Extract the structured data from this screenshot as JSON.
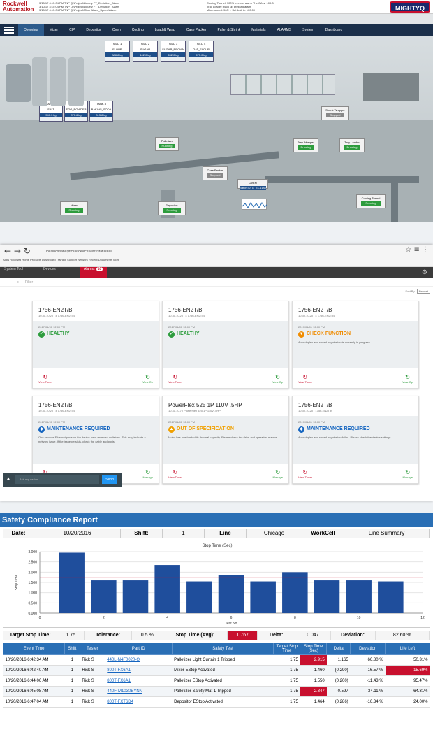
{
  "hmi": {
    "brand": {
      "line1": "Rockwell",
      "line2": "Automation"
    },
    "alarms": [
      "3/10/17 4:15:04 PM   TNP    Q:\\Project\\Liquefy FT_Deviation_Alarm",
      "3/10/17 4:15:04 PM   TNP    Q:\\Project\\Liquefy FT_Deviation_Alarm",
      "3/10/17 4:15:04 PM   TNP    Q:\\Project\\Mixer Alarm_Speed/Alarm"
    ],
    "alarms_right": [
      "Cooling Tunnel: 100% overrun alarm  The CA is: 100.3",
      "Tray Loader: back up pressed alarm",
      "Mixer speed: 960+ . Set limit is: 100.00"
    ],
    "logo_right": "MIGHTYQ",
    "tabs": [
      "Overview",
      "Mixer",
      "CIP",
      "Depositor",
      "Oven",
      "Cooling",
      "Load & Wrap",
      "Case Packer",
      "Pallet & Shrink",
      "Materials",
      "ALARMS",
      "System",
      "Dashboard"
    ],
    "silos": [
      {
        "name": "SILO 1",
        "material": "FLOUR",
        "value": "888.8 kg"
      },
      {
        "name": "SILO 2",
        "material": "SUGAR",
        "value": "102.0 kg"
      },
      {
        "name": "SILO 3",
        "material": "SUGAR_BROWN",
        "value": "282.0 kg"
      },
      {
        "name": "SILO 4",
        "material": "OAT_FLOUR",
        "value": "673.0 kg"
      }
    ],
    "tanks": [
      {
        "name": "TANK 1",
        "material": "SALT",
        "value": "540.3 kg"
      },
      {
        "name": "TANK 2",
        "material": "EGG_POWDER",
        "value": "870.6 kg"
      },
      {
        "name": "TANK 3",
        "material": "BAKING_SODA",
        "value": "313.8 kg"
      }
    ],
    "machines": [
      {
        "name": "Shrink Wrapper",
        "status": "Stopped"
      },
      {
        "name": "Palletizer",
        "status": "Running"
      },
      {
        "name": "Tray Wrapper",
        "status": "Running"
      },
      {
        "name": "Tray Loader",
        "status": "Running"
      },
      {
        "name": "Case Packer",
        "status": "Stopped"
      },
      {
        "name": "Cooling Tunnel",
        "status": "Running"
      },
      {
        "name": "Mixer",
        "status": "Running"
      },
      {
        "name": "Depositor",
        "status": "Running"
      },
      {
        "name": "OVEN",
        "status": "Batch ID: G_24-4184"
      }
    ]
  },
  "browser": {
    "address": "localhost/analytics/#/devices/list?status=all",
    "bookmarks": "Apps  Rockwell  Home  Products  Dashboard  Training  Support  Network  Recent  Documents  More",
    "tabs": {
      "t1": "System Tool",
      "t2": "Devices",
      "t3": "Alarms",
      "alarm_count": "10"
    },
    "filter_placeholder": "Filter",
    "sort_label": "Sort By",
    "sort_value": "Newest",
    "cards": [
      {
        "title": "1756-EN2T/B",
        "sub": "10.30.10.20 | 4   1756-EN2T/B",
        "date": "2017/01/01 12:00 PM",
        "status": "HEALTHY",
        "kind": "ok",
        "desc": "",
        "left": "View Tuner",
        "right": "View Op"
      },
      {
        "title": "1756-EN2T/B",
        "sub": "10.30.10.20 | 4   1756-EN2T/B",
        "date": "2017/01/01 12:00 PM",
        "status": "HEALTHY",
        "kind": "ok",
        "desc": "",
        "left": "View Tuner",
        "right": "View Op"
      },
      {
        "title": "1756-EN2T/B",
        "sub": "10.30.10.20 | 4   1756-EN2T/B",
        "date": "2017/01/01 12:00 PM",
        "status": "CHECK FUNCTION",
        "kind": "check",
        "desc": "Auto duplex and speed negotiation is currently in progress.",
        "left": "View Tuner",
        "right": "View Op"
      },
      {
        "title": "1756-EN2T/B",
        "sub": "10.30.10.20 | 4   1756-EN2T/B",
        "date": "2017/01/01 12:00 PM",
        "status": "MAINTENANCE REQUIRED",
        "kind": "maint",
        "desc": "One or more Ethernet ports on the device have received collisions. This may indicate a network issue. If the issue persists, check the cable and ports.",
        "left": "View Tuner",
        "right": "Manage"
      },
      {
        "title": "PowerFlex 525 1P 110V .5HP",
        "sub": "10.31.10.7 | PowerFlex 525 1P 110V .5HP",
        "date": "2017/01/01 12:00 PM",
        "status": "OUT OF SPECIFICATION",
        "kind": "spec",
        "desc": "Motor has overloaded its thermal capacity. Please check the drive and operation manual.",
        "left": "View Tuner",
        "right": "Manage"
      },
      {
        "title": "1756-EN2T/B",
        "sub": "10.30.10.20 | 1756-EN2T/B",
        "date": "2017/01/01 12:00 PM",
        "status": "MAINTENANCE REQUIRED",
        "kind": "maint",
        "desc": "Auto duplex and speed negotiation failed. Please check the device settings.",
        "left": "View Tuner",
        "right": "Manage"
      }
    ],
    "chat": {
      "placeholder": "Ask a question",
      "button": "Send"
    }
  },
  "report": {
    "title": "Safety Compliance Report",
    "date_label": "Date:",
    "date": "10/20/2016",
    "shift_label": "Shift:",
    "shift": "1",
    "line_label": "Line",
    "line": "Chicago",
    "workcell_label": "WorkCell",
    "workcell": "Line Summary",
    "target_stop_label": "Target Stop Time:",
    "target_stop": "1.75",
    "tolerance_label": "Tolerance:",
    "tolerance": "0.5 %",
    "avg_label": "Stop Time (Avg):",
    "avg": "1.767",
    "delta_label": "Delta:",
    "delta": "0.047",
    "deviation_label": "Deviation:",
    "deviation": "82.60 %",
    "columns": [
      "Event Time",
      "Shift",
      "Tester",
      "Part ID",
      "Safety Test",
      "Target Stop Time",
      "Stop Time (Sec)",
      "Delta",
      "Deviation",
      "Life Left"
    ],
    "rows": [
      {
        "time": "10/20/2016 6:42:34 AM",
        "shift": "1",
        "tester": "Rick S",
        "part": "440L-N4F0020-Q",
        "test": "Palletizer Light Curtain 1 Tripped",
        "target": "1.75",
        "stop": "2.915",
        "delta": "1.165",
        "dev": "66.80 %",
        "life": "50.31%",
        "stop_red": true,
        "life_red": false
      },
      {
        "time": "10/20/2016 6:42:40 AM",
        "shift": "1",
        "tester": "Rick S",
        "part": "800T-FX6A1",
        "test": "Mixer EStop Activated",
        "target": "1.75",
        "stop": "1.460",
        "delta": "(0.290)",
        "dev": "-16.57 %",
        "life": "15.69%",
        "stop_red": false,
        "life_red": true
      },
      {
        "time": "10/20/2016 6:44:06 AM",
        "shift": "1",
        "tester": "Rick S",
        "part": "800T-FX6A1",
        "test": "Palletizer EStop Activated",
        "target": "1.75",
        "stop": "1.550",
        "delta": "(0.200)",
        "dev": "-11.43 %",
        "life": "95.47%",
        "stop_red": false,
        "life_red": false
      },
      {
        "time": "10/20/2016 6:45:08 AM",
        "shift": "1",
        "tester": "Rick S",
        "part": "440F-M1030BYNN",
        "test": "Palletizer Safety Mat 1 Tripped",
        "target": "1.75",
        "stop": "2.347",
        "delta": "0.597",
        "dev": "34.11 %",
        "life": "64.31%",
        "stop_red": true,
        "life_red": false
      },
      {
        "time": "10/20/2016 6:47:04 AM",
        "shift": "1",
        "tester": "Rick S",
        "part": "800T-FXT6D4",
        "test": "Depositor EStop Activated",
        "target": "1.75",
        "stop": "1.464",
        "delta": "(0.286)",
        "dev": "-16.34 %",
        "life": "24.00%",
        "stop_red": false,
        "life_red": false
      }
    ]
  },
  "chart_data": {
    "type": "bar",
    "title": "Stop Time (Sec)",
    "xlabel": "Test No",
    "ylabel": "Stop Time",
    "x": [
      1,
      2,
      3,
      4,
      5,
      6,
      7,
      8,
      9,
      10,
      11
    ],
    "values": [
      2.95,
      1.6,
      1.6,
      2.35,
      1.55,
      1.85,
      1.55,
      2.0,
      1.6,
      1.6,
      1.55
    ],
    "reference_line": 1.75,
    "xlim": [
      0,
      12
    ],
    "ylim": [
      0,
      3.0
    ],
    "yticks": [
      "3.000",
      "2.500",
      "2.000",
      "1.500",
      "1.000",
      "0.500",
      "0.000"
    ],
    "xticks": [
      "0",
      "2",
      "4",
      "6",
      "8",
      "10",
      "12"
    ],
    "bar_color": "#1f4e9c",
    "line_color": "#c8102e"
  }
}
